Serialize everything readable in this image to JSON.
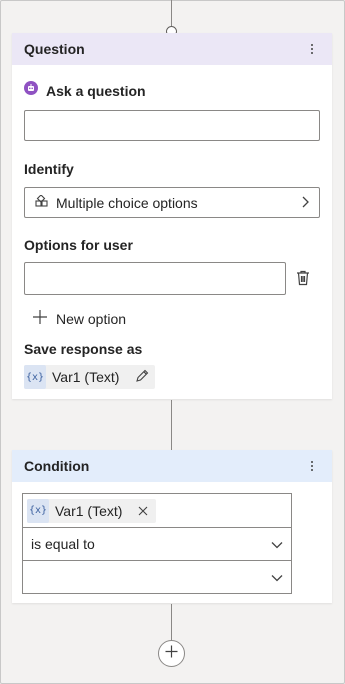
{
  "question_node": {
    "title": "Question",
    "prompt_label": "Ask a question",
    "prompt_value": "",
    "identify_label": "Identify",
    "identify_value": "Multiple choice options",
    "options_label": "Options for user",
    "option_value": "",
    "new_option_label": "New option",
    "save_label": "Save response as",
    "variable_icon": "{x}",
    "variable_name": "Var1 (Text)"
  },
  "condition_node": {
    "title": "Condition",
    "variable_icon": "{x}",
    "variable_name": "Var1 (Text)",
    "operator": "is equal to",
    "value": ""
  },
  "colors": {
    "question_header": "#ebe7f6",
    "condition_header": "#e3edfb",
    "question_icon": "#8f52c2",
    "variable_chip": "#dbe4f3",
    "accent_pen": "#0f6cbd"
  }
}
